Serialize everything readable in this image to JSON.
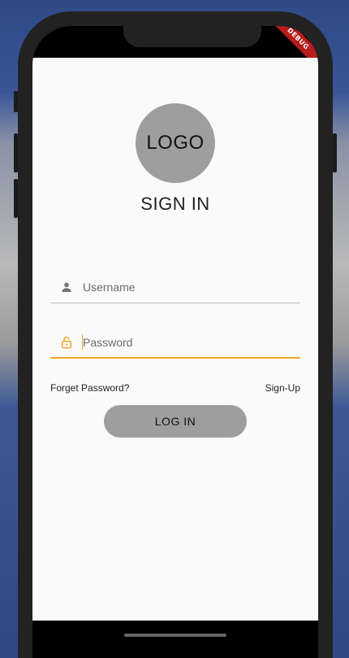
{
  "debug_banner": "DEBUG",
  "logo": "LOGO",
  "title": "SIGN IN",
  "username": {
    "placeholder": "Username",
    "icon": "person-icon"
  },
  "password": {
    "placeholder": "Password",
    "icon": "lock-open-icon",
    "focused": true
  },
  "links": {
    "forget_password": "Forget Password?",
    "sign_up": "Sign-Up"
  },
  "login_button": "LOG IN",
  "colors": {
    "accent": "#f5a623",
    "button": "#9e9e9e",
    "background": "#fafafa"
  }
}
